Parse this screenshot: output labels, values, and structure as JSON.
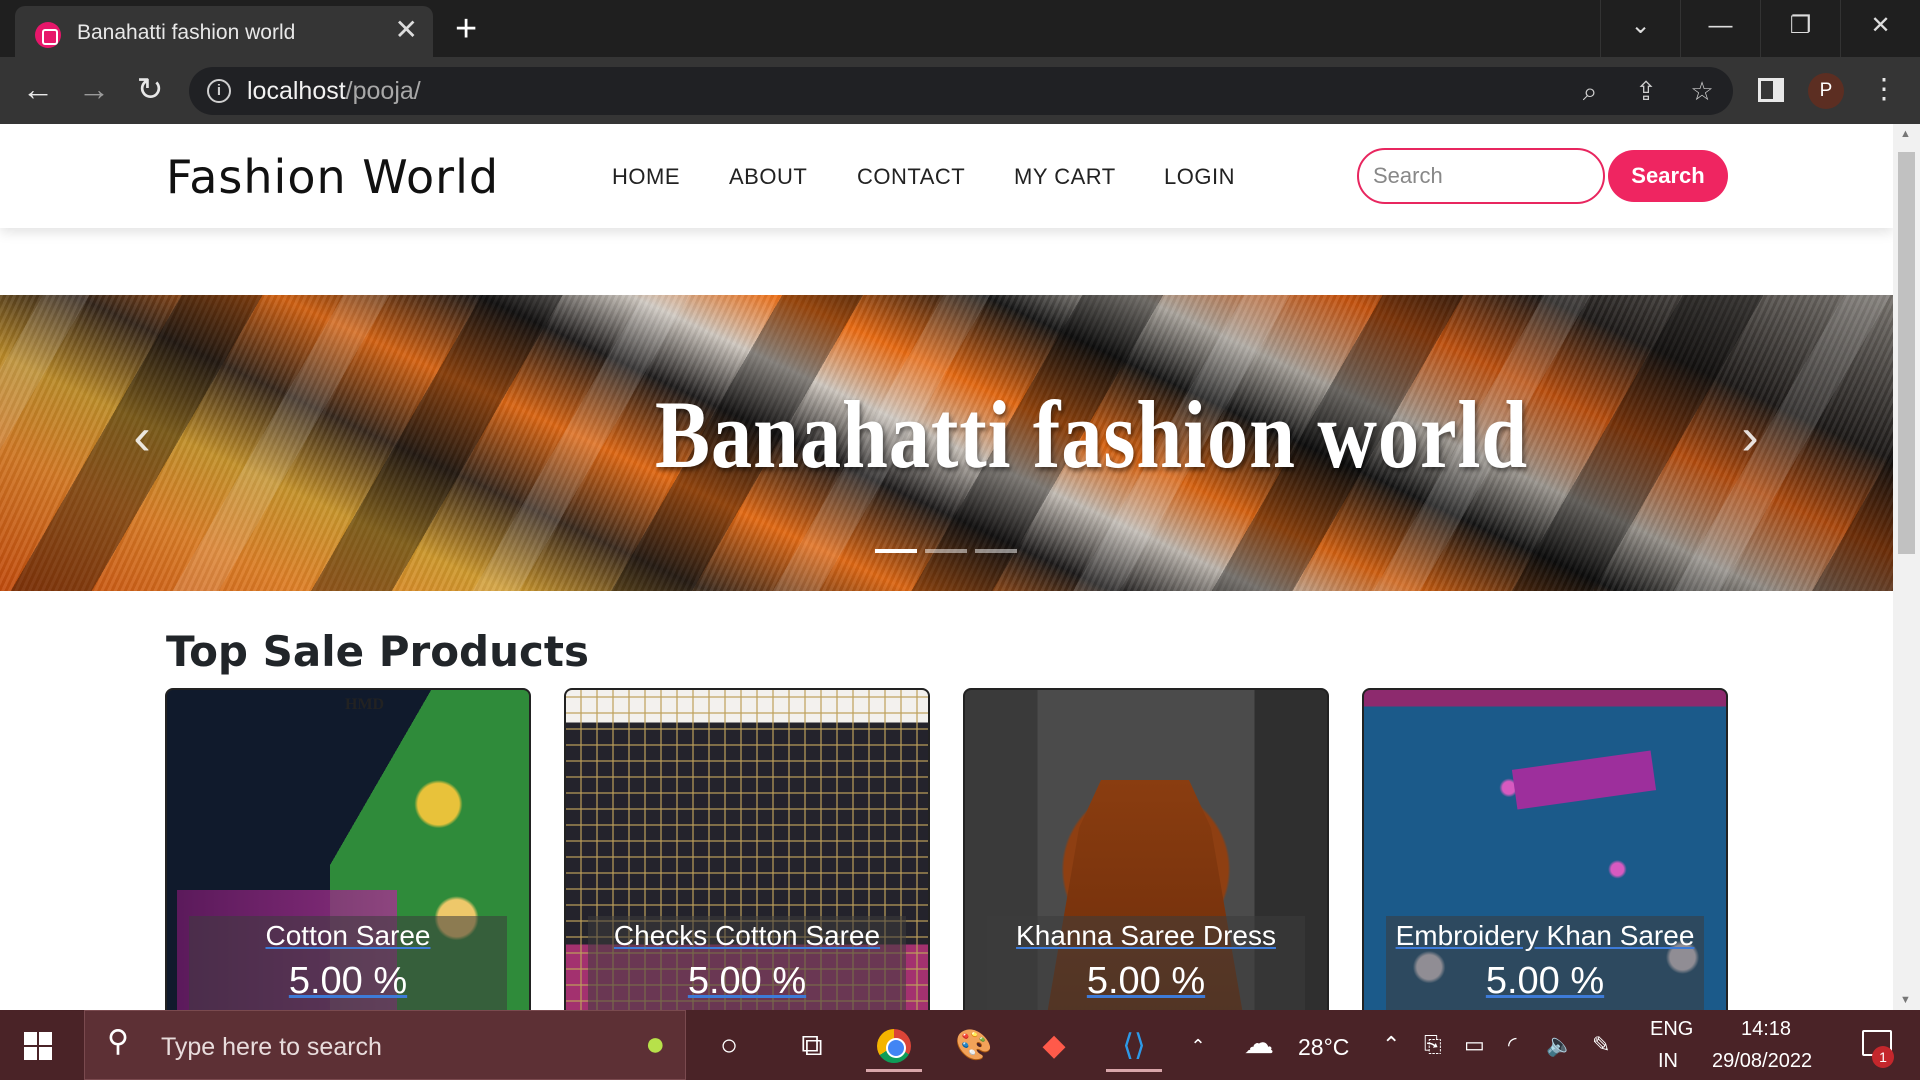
{
  "browser": {
    "tab_title": "Banahatti fashion world",
    "tab_close": "✕",
    "new_tab": "+",
    "url_host": "localhost",
    "url_path": "/pooja/",
    "profile_initial": "P",
    "window_controls": {
      "tabs_dropdown": "⌄",
      "minimize": "—",
      "restore": "❐",
      "close": "✕"
    },
    "icons": [
      "back-icon",
      "forward-icon",
      "reload-icon",
      "info-icon",
      "zoom-icon",
      "share-icon",
      "star-icon",
      "side-panel-icon",
      "menu-icon"
    ]
  },
  "site": {
    "brand": "Fashion World",
    "nav": [
      "HOME",
      "ABOUT",
      "CONTACT",
      "MY CART",
      "LOGIN"
    ],
    "search_placeholder": "Search",
    "search_button": "Search",
    "accent_color": "#ef2561"
  },
  "hero": {
    "title": "Banahatti fashion world",
    "slides": 3,
    "active_slide": 1
  },
  "products": {
    "section_title": "Top Sale Products",
    "items": [
      {
        "name": "Cotton Saree",
        "price": "5.00 %"
      },
      {
        "name": "Checks Cotton Saree",
        "price": "5.00 %"
      },
      {
        "name": "Khanna Saree Dress",
        "price": "5.00 %"
      },
      {
        "name": "Embroidery Khan Saree",
        "price": "5.00 %"
      }
    ]
  },
  "taskbar": {
    "search_placeholder": "Type here to search",
    "weather": "28°C",
    "lang_top": "ENG",
    "lang_bottom": "IN",
    "time": "14:18",
    "date": "29/08/2022",
    "notification_count": "1"
  }
}
